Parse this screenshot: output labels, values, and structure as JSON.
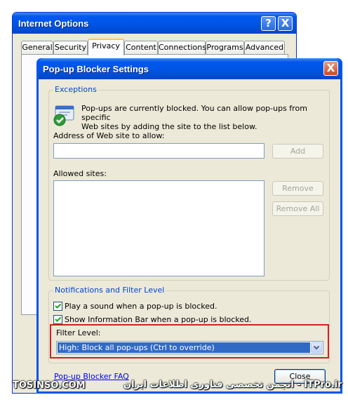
{
  "back_window": {
    "title": "Internet Options",
    "help_button": "?",
    "close_button": "X",
    "tabs": [
      "General",
      "Security",
      "Privacy",
      "Content",
      "Connections",
      "Programs",
      "Advanced"
    ],
    "active_tab": "Privacy"
  },
  "dialog": {
    "title": "Pop-up Blocker Settings",
    "close_button": "X",
    "exceptions": {
      "group_label": "Exceptions",
      "info_line1": "Pop-ups are currently blocked.  You can allow pop-ups from specific",
      "info_line2": "Web sites by adding the site to the list below.",
      "address_label": "Address of Web site to allow:",
      "address_value": "",
      "add_button": "Add",
      "allowed_label": "Allowed sites:",
      "allowed_sites": [],
      "remove_button": "Remove",
      "remove_all_button": "Remove All"
    },
    "notifications": {
      "group_label": "Notifications and Filter Level",
      "play_sound_label": "Play a sound when a pop-up is blocked.",
      "play_sound_checked": true,
      "info_bar_label": "Show Information Bar when a pop-up is blocked.",
      "info_bar_checked": true,
      "filter_level_label": "Filter Level:",
      "filter_level_value": "High: Block all pop-ups (Ctrl to override)"
    },
    "faq_link": "Pop-up Blocker FAQ",
    "close_label": "Close"
  },
  "watermark": {
    "left": "TOSINSO.COM",
    "right": "ITPro.ir - انجمن تخصصی فناوری اطلاعات ایران"
  },
  "colors": {
    "titlebar": "#0054e3",
    "group_label": "#0046d5",
    "highlight_box": "#d42020",
    "selection": "#316ac5",
    "link": "#0000ff"
  }
}
